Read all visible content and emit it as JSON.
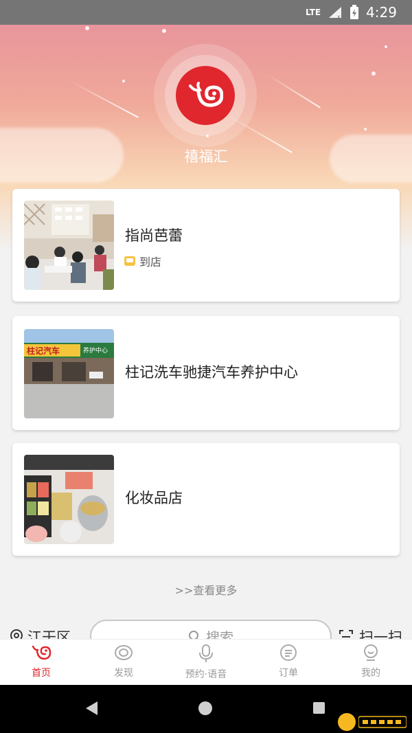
{
  "status_bar": {
    "network": "LTE",
    "time": "4:29"
  },
  "app": {
    "name": "禧福汇"
  },
  "stores": [
    {
      "name": "指尚芭蕾",
      "tag": "到店"
    },
    {
      "name": "柱记洗车驰捷汽车养护中心",
      "tag": ""
    },
    {
      "name": "化妆品店",
      "tag": ""
    }
  ],
  "more_link": ">>查看更多",
  "location": {
    "label": "江干区"
  },
  "search": {
    "placeholder": "搜索"
  },
  "scan": {
    "label": "扫一扫"
  },
  "tabs": [
    {
      "label": "首页",
      "icon": "home-whale-icon",
      "active": true
    },
    {
      "label": "发现",
      "icon": "eye-icon",
      "active": false
    },
    {
      "label": "预约·语音",
      "icon": "microphone-icon",
      "active": false
    },
    {
      "label": "订单",
      "icon": "order-list-icon",
      "active": false
    },
    {
      "label": "我的",
      "icon": "profile-icon",
      "active": false
    }
  ],
  "colors": {
    "accent": "#e0272d",
    "tag": "#f6c244"
  }
}
